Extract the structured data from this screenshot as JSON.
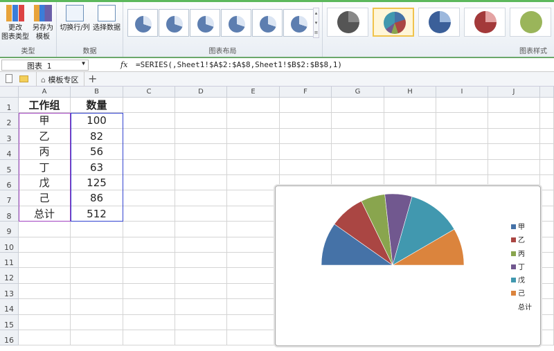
{
  "ribbon": {
    "type_group": {
      "label": "类型",
      "change_type": "更改\n图表类型",
      "save_template": "另存为\n模板"
    },
    "data_group": {
      "label": "数据",
      "switch_row_col": "切换行/列",
      "select_data": "选择数据"
    },
    "layout_group": {
      "label": "图表布局"
    },
    "style_group": {
      "label": "图表样式"
    }
  },
  "formula_bar": {
    "name_box": "图表 1",
    "fx": "fx",
    "formula": "=SERIES(,Sheet1!$A$2:$A$8,Sheet1!$B$2:$B$8,1)"
  },
  "tabs": {
    "template_zone": "模板专区",
    "add": "+"
  },
  "columns": [
    "A",
    "B",
    "C",
    "D",
    "E",
    "F",
    "G",
    "H",
    "I",
    "J"
  ],
  "rows": [
    "1",
    "2",
    "3",
    "4",
    "5",
    "6",
    "7",
    "8",
    "9",
    "10",
    "11",
    "12",
    "13",
    "14",
    "15",
    "16"
  ],
  "table": {
    "headers": [
      "工作组",
      "数量"
    ],
    "data": [
      [
        "甲",
        "100"
      ],
      [
        "乙",
        "82"
      ],
      [
        "丙",
        "56"
      ],
      [
        "丁",
        "63"
      ],
      [
        "戊",
        "125"
      ],
      [
        "己",
        "86"
      ],
      [
        "总计",
        "512"
      ]
    ]
  },
  "chart_data": {
    "type": "pie",
    "categories": [
      "甲",
      "乙",
      "丙",
      "丁",
      "戊",
      "己",
      "总计"
    ],
    "values": [
      100,
      82,
      56,
      63,
      125,
      86,
      512
    ],
    "first_slice_angle": 270,
    "hidden_slices": [
      "总计"
    ],
    "colors": [
      "#4572a7",
      "#aa4643",
      "#89a54e",
      "#71588f",
      "#4198af",
      "#db843d",
      "none"
    ],
    "legend": "right"
  }
}
